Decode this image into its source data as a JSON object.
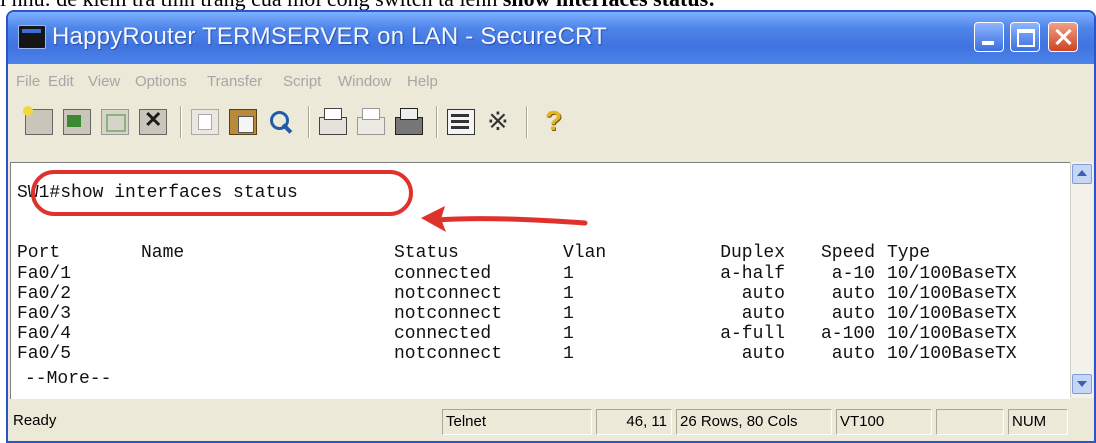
{
  "caption": {
    "prefix": "i nhu: de kiem tra tinh trang cua moi cong switch ta lenh ",
    "command": "show interfaces status",
    "suffix": ":"
  },
  "window": {
    "title": "HappyRouter TERMSERVER on LAN - SecureCRT",
    "controls": {
      "minimize": "minimize-icon",
      "maximize": "maximize-icon",
      "close": "close-icon"
    }
  },
  "menu": [
    "File",
    "Edit",
    "View",
    "Options",
    "Transfer",
    "Script",
    "Window",
    "Help"
  ],
  "toolbar": {
    "icons": [
      "connect-icon",
      "quick-connect-icon",
      "reconnect-icon",
      "disconnect-icon",
      "copy-icon",
      "paste-icon",
      "find-icon",
      "print-icon",
      "print-selection-icon",
      "print-setup-icon",
      "session-options-icon",
      "keymap-icon",
      "help-icon"
    ]
  },
  "terminal": {
    "prompt": "SW1#",
    "command": "show interfaces status",
    "headers": {
      "port": "Port",
      "name": "Name",
      "status": "Status",
      "vlan": "Vlan",
      "duplex": "Duplex",
      "speed": "Speed",
      "type": "Type"
    },
    "rows": [
      {
        "port": "Fa0/1",
        "name": "",
        "status": "connected",
        "vlan": "1",
        "duplex": "a-half",
        "speed": "a-10",
        "type": "10/100BaseTX"
      },
      {
        "port": "Fa0/2",
        "name": "",
        "status": "notconnect",
        "vlan": "1",
        "duplex": "auto",
        "speed": "auto",
        "type": "10/100BaseTX"
      },
      {
        "port": "Fa0/3",
        "name": "",
        "status": "notconnect",
        "vlan": "1",
        "duplex": "auto",
        "speed": "auto",
        "type": "10/100BaseTX"
      },
      {
        "port": "Fa0/4",
        "name": "",
        "status": "connected",
        "vlan": "1",
        "duplex": "a-full",
        "speed": "a-100",
        "type": "10/100BaseTX"
      },
      {
        "port": "Fa0/5",
        "name": "",
        "status": "notconnect",
        "vlan": "1",
        "duplex": "auto",
        "speed": "auto",
        "type": "10/100BaseTX"
      }
    ],
    "more": "--More--",
    "highlight_color": "#e0322c"
  },
  "statusbar": {
    "ready": "Ready",
    "protocol": "Telnet",
    "cursor": "46, 11",
    "size": "26 Rows, 80 Cols",
    "emulation": "VT100",
    "num": "NUM"
  }
}
